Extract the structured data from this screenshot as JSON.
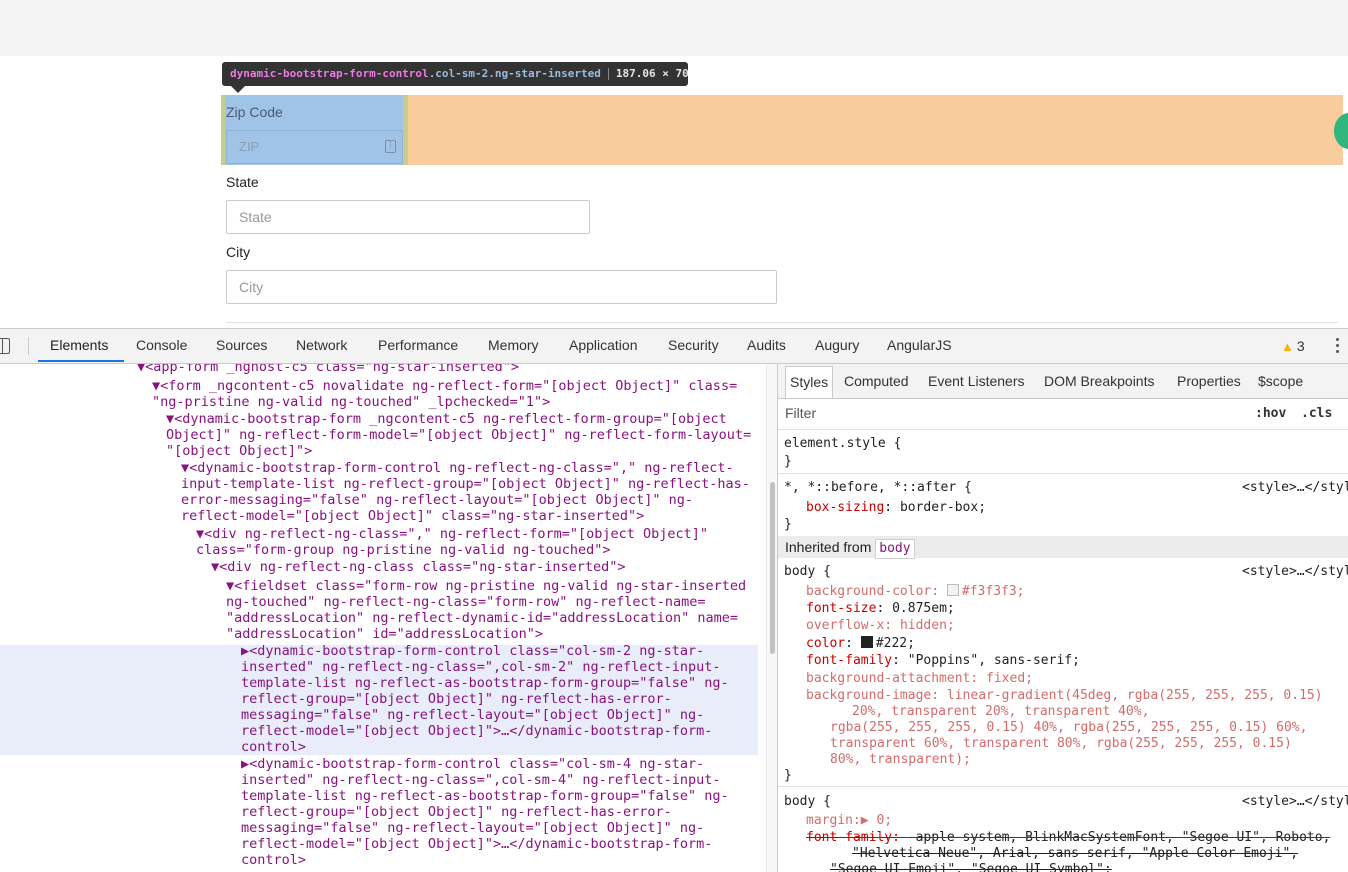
{
  "tooltip": {
    "tag": "dynamic-bootstrap-form-control",
    "classes": ".col-sm-2.ng-star-inserted",
    "dimensions": "187.06 × 70"
  },
  "form": {
    "zip_label": "Zip Code",
    "zip_placeholder": "ZIP",
    "state_label": "State",
    "state_placeholder": "State",
    "city_label": "City",
    "city_placeholder": "City"
  },
  "devtools": {
    "tabs": [
      "Elements",
      "Console",
      "Sources",
      "Network",
      "Performance",
      "Memory",
      "Application",
      "Security",
      "Audits",
      "Augury",
      "AngularJS"
    ],
    "warning_count": "3",
    "elements_lines": [
      "▼<app-form _nghost-c5 class=\"ng-star-inserted\">",
      "▼<form _ngcontent-c5 novalidate ng-reflect-form=\"[object Object]\" class=",
      "\"ng-pristine ng-valid ng-touched\" _lpchecked=\"1\">",
      "▼<dynamic-bootstrap-form _ngcontent-c5 ng-reflect-form-group=\"[object",
      "Object]\" ng-reflect-form-model=\"[object Object]\" ng-reflect-form-layout=",
      "\"[object Object]\">",
      "▼<dynamic-bootstrap-form-control ng-reflect-ng-class=\",\" ng-reflect-",
      "input-template-list ng-reflect-group=\"[object Object]\" ng-reflect-has-",
      "error-messaging=\"false\" ng-reflect-layout=\"[object Object]\" ng-",
      "reflect-model=\"[object Object]\" class=\"ng-star-inserted\">",
      "▼<div ng-reflect-ng-class=\",\" ng-reflect-form=\"[object Object]\"",
      "class=\"form-group ng-pristine ng-valid ng-touched\">",
      "▼<div ng-reflect-ng-class class=\"ng-star-inserted\">",
      "▼<fieldset class=\"form-row ng-pristine ng-valid ng-star-inserted",
      "ng-touched\" ng-reflect-ng-class=\"form-row\" ng-reflect-name=",
      "\"addressLocation\" ng-reflect-dynamic-id=\"addressLocation\" name=",
      "\"addressLocation\" id=\"addressLocation\">",
      "▶<dynamic-bootstrap-form-control class=\"col-sm-2 ng-star-",
      "inserted\" ng-reflect-ng-class=\",col-sm-2\" ng-reflect-input-",
      "template-list ng-reflect-as-bootstrap-form-group=\"false\" ng-",
      "reflect-group=\"[object Object]\" ng-reflect-has-error-",
      "messaging=\"false\" ng-reflect-layout=\"[object Object]\" ng-",
      "reflect-model=\"[object Object]\">…</dynamic-bootstrap-form-",
      "control>",
      "▶<dynamic-bootstrap-form-control class=\"col-sm-4 ng-star-",
      "inserted\" ng-reflect-ng-class=\",col-sm-4\" ng-reflect-input-",
      "template-list ng-reflect-as-bootstrap-form-group=\"false\" ng-",
      "reflect-group=\"[object Object]\" ng-reflect-has-error-",
      "messaging=\"false\" ng-reflect-layout=\"[object Object]\" ng-",
      "reflect-model=\"[object Object]\">…</dynamic-bootstrap-form-",
      "control>"
    ],
    "styles_tabs": [
      "Styles",
      "Computed",
      "Event Listeners",
      "DOM Breakpoints",
      "Properties",
      "$scope"
    ],
    "filter_placeholder": "Filter",
    "hov": ":hov",
    "cls": ".cls",
    "rules": {
      "element_style_open": "element.style {",
      "close": "}",
      "universal_selector": "*, *::before, *::after {",
      "box_sizing_prop": "box-sizing",
      "box_sizing_val": "border-box;",
      "source": "<style>…</style>",
      "inherited_label": "Inherited from",
      "inherited_tag": "body",
      "body_open": "body {",
      "bg_color_prop": "background-color",
      "bg_color_val": "#f3f3f3;",
      "font_size_prop": "font-size",
      "font_size_val": "0.875em;",
      "overflow_prop": "overflow-x",
      "overflow_val": "hidden;",
      "color_prop": "color",
      "color_val": "#222;",
      "font_family_prop": "font-family",
      "font_family_val": "\"Poppins\", sans-serif;",
      "bg_attach_prop": "background-attachment",
      "bg_attach_val": "fixed;",
      "bg_image_prop": "background-image",
      "bg_image_line1": "linear-gradient(45deg, rgba(255, 255, 255, 0.15)",
      "bg_image_line2": "20%, transparent 20%, transparent 40%,",
      "bg_image_line3": "rgba(255, 255, 255, 0.15) 40%, rgba(255, 255, 255, 0.15) 60%,",
      "bg_image_line4": "transparent 60%, transparent 80%, rgba(255, 255, 255, 0.15)",
      "bg_image_line5": "80%, transparent);",
      "margin_prop": "margin",
      "margin_val": "0;",
      "font_family2_prop": "font-family",
      "font_family2_line1": "-apple-system, BlinkMacSystemFont, \"Segoe UI\", Roboto,",
      "font_family2_line2": "\"Helvetica Neue\", Arial, sans-serif, \"Apple Color Emoji\",",
      "font_family2_line3": "\"Segoe UI Emoji\", \"Segoe UI Symbol\";"
    }
  },
  "colors": {
    "highlight_content": "#9fc4e7",
    "highlight_margin": "#f9cc9d",
    "highlight_padding": "#c3d08b",
    "accent": "#1a73e8"
  }
}
